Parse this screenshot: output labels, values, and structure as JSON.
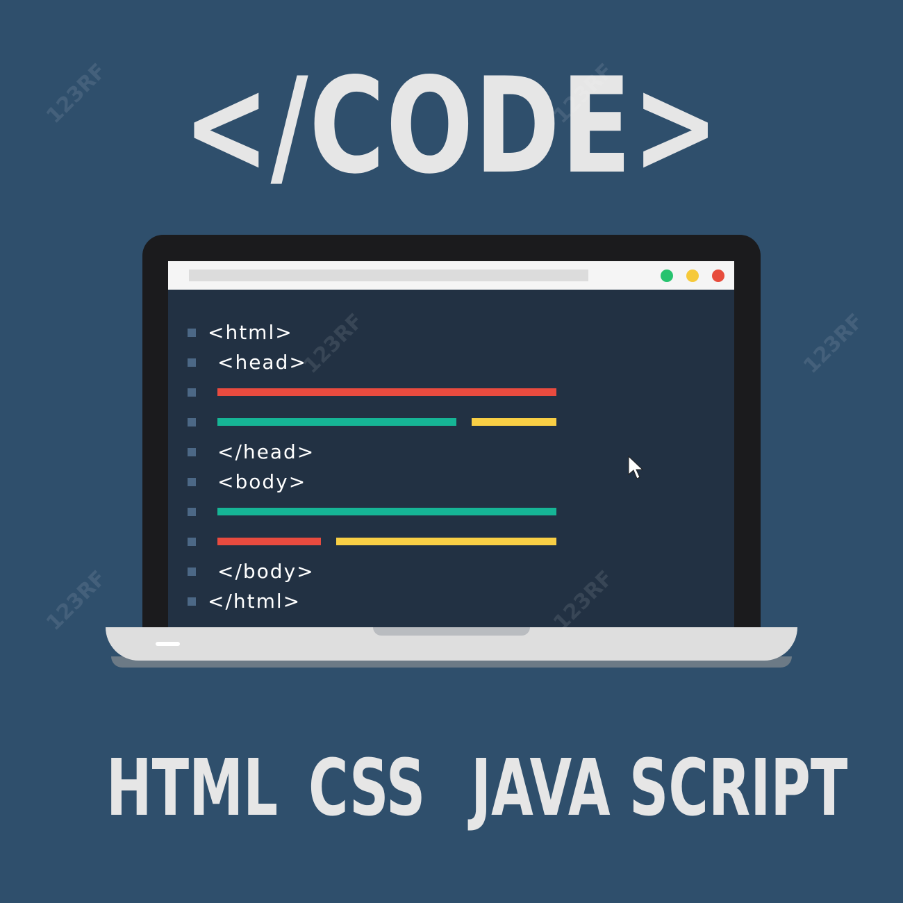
{
  "headline": "</CODE>",
  "browser": {
    "dots": [
      {
        "name": "green",
        "color": "#27c36f"
      },
      {
        "name": "yellow",
        "color": "#f6c93a"
      },
      {
        "name": "red",
        "color": "#e74c3c"
      }
    ]
  },
  "code_lines": [
    {
      "text": "<html>"
    },
    {
      "text": "<head>"
    },
    {
      "text": ""
    },
    {
      "text": ""
    },
    {
      "text": "</head>"
    },
    {
      "text": "<body>"
    },
    {
      "text": ""
    },
    {
      "text": ""
    },
    {
      "text": "</body>"
    },
    {
      "text": "</html>"
    }
  ],
  "technologies": [
    "HTML",
    "CSS",
    "JAVA SCRIPT"
  ],
  "watermark": "123RF",
  "colors": {
    "background": "#2f4f6c",
    "editor": "#223143",
    "red": "#e94b3f",
    "teal": "#16b596",
    "yellow": "#f9cf45",
    "text_light": "#e6e6e6"
  }
}
